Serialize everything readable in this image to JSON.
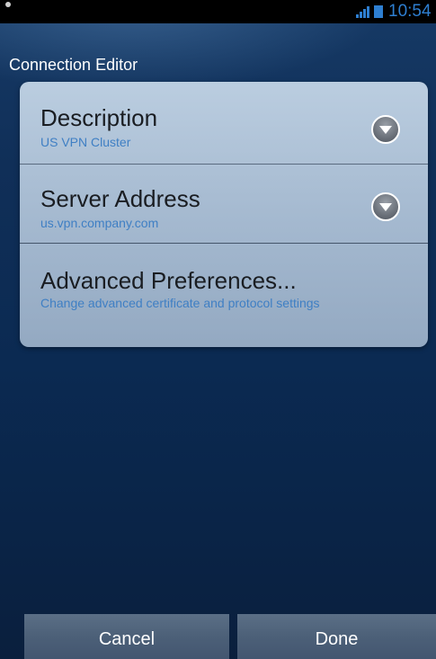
{
  "status_bar": {
    "time": "10:54",
    "accent_color": "#2e7fd1"
  },
  "header": {
    "title": "Connection Editor"
  },
  "settings": {
    "items": [
      {
        "label": "Description",
        "value": "US VPN Cluster",
        "icon": "chevron-down-icon"
      },
      {
        "label": "Server Address",
        "value": "us.vpn.company.com",
        "icon": "chevron-down-icon"
      },
      {
        "label": "Advanced Preferences...",
        "value": "Change advanced certificate and protocol settings"
      }
    ]
  },
  "footer": {
    "cancel_label": "Cancel",
    "done_label": "Done"
  },
  "colors": {
    "subtext": "#3f7fc4",
    "background": "#0b2a52"
  }
}
